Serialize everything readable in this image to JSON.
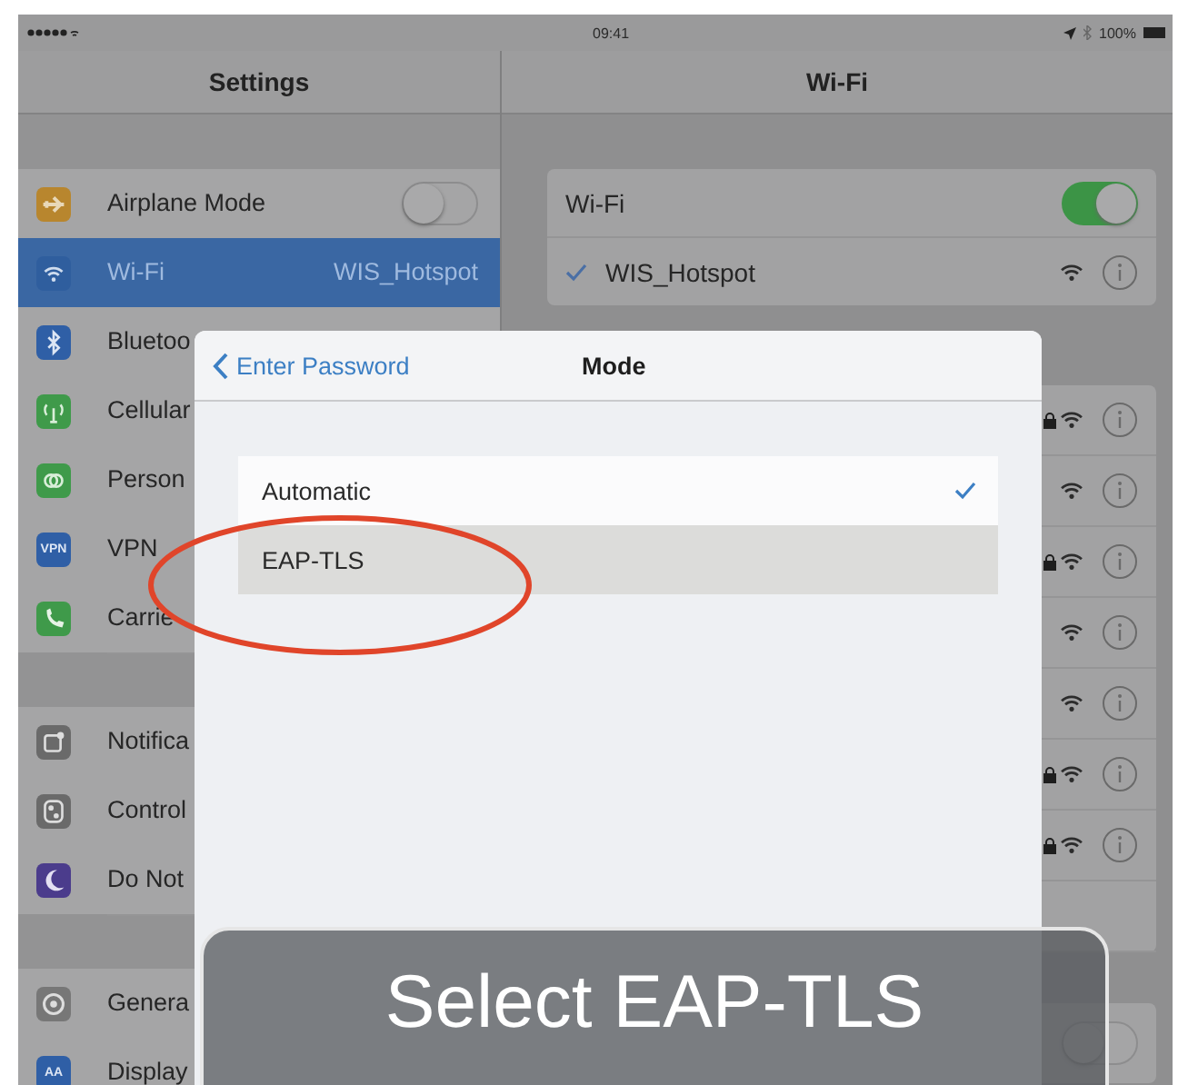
{
  "status_bar": {
    "time": "09:41",
    "battery": "100%"
  },
  "sidebar": {
    "title": "Settings",
    "groups": [
      [
        {
          "label": "Airplane Mode",
          "selected": false,
          "toggle": {
            "on": false
          }
        },
        {
          "label": "Wi-Fi",
          "selected": true,
          "value": "WIS_Hotspot"
        },
        {
          "label": "Bluetoo",
          "selected": false
        },
        {
          "label": "Cellular",
          "selected": false
        },
        {
          "label": "Person",
          "selected": false
        },
        {
          "label": "VPN",
          "icon_text": "VPN",
          "selected": false
        },
        {
          "label": "Carrie",
          "selected": false
        }
      ],
      [
        {
          "label": "Notifica",
          "selected": false
        },
        {
          "label": "Control",
          "selected": false
        },
        {
          "label": "Do Not",
          "selected": false
        }
      ],
      [
        {
          "label": "Genera",
          "selected": false
        },
        {
          "label": "Display",
          "icon_text": "AA",
          "selected": false
        }
      ]
    ]
  },
  "detail": {
    "title": "Wi-Fi",
    "wifi_toggle": {
      "label": "Wi-Fi",
      "on": true
    },
    "connected": {
      "name": "WIS_Hotspot",
      "checked": true
    },
    "networks": [
      {
        "locked": true
      },
      {
        "locked": false
      },
      {
        "locked": true
      },
      {
        "locked": false
      },
      {
        "locked": false
      },
      {
        "locked": true
      },
      {
        "locked": true
      }
    ],
    "bottom_toggle": {
      "on": false
    }
  },
  "modal": {
    "back": "Enter Password",
    "title": "Mode",
    "options": [
      {
        "label": "Automatic",
        "checked": true,
        "selected": false
      },
      {
        "label": "EAP-TLS",
        "checked": false,
        "selected": true
      }
    ]
  },
  "caption": "Select EAP-TLS"
}
